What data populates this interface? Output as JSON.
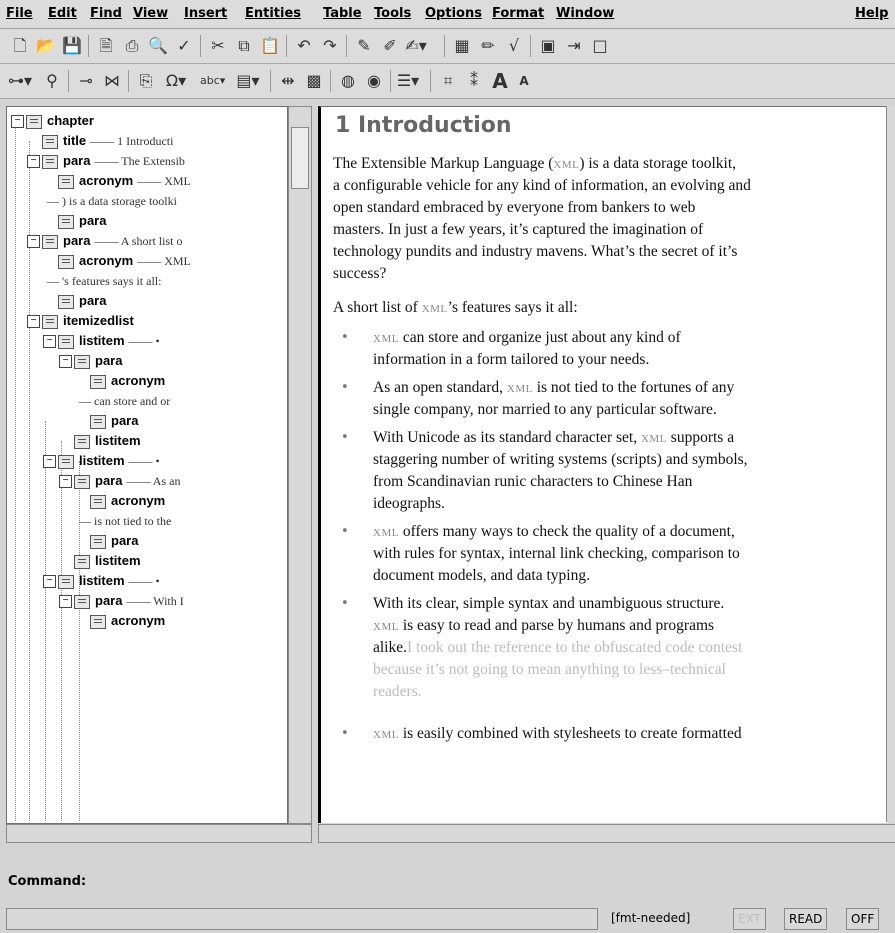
{
  "menubar": {
    "items": [
      "File",
      "Edit",
      "Find",
      "View",
      "Insert",
      "Entities",
      "Table",
      "Tools",
      "Options",
      "Format",
      "Window"
    ],
    "help": "Help"
  },
  "toolbar1": {
    "icons": [
      "new-document-icon",
      "open-folder-icon",
      "save-icon",
      "print-preview-icon",
      "print-icon",
      "find-icon",
      "spellcheck-icon",
      "cut-icon",
      "copy-icon",
      "paste-icon",
      "undo-icon",
      "redo-icon",
      "insert-element-icon",
      "split-element-icon",
      "change-element-icon",
      "table-icon",
      "edit-table-icon",
      "equation-icon",
      "image-icon",
      "export-icon",
      "layout-icon"
    ]
  },
  "toolbar2": {
    "icons": [
      "structure-icon",
      "zoom-icon",
      "link-icon",
      "markup-icon",
      "clipboard-icon",
      "special-char-icon",
      "text-style-icon",
      "entity-icon",
      "gutter-icon",
      "graphic-icon",
      "globe-icon",
      "web-icon",
      "list-icon",
      "tag-icon",
      "attributes-icon",
      "bigger-font-icon",
      "smaller-font-icon"
    ],
    "glyphs": {
      "omega": "Ω",
      "abc": "abc",
      "A_big": "A",
      "A_small": "A"
    }
  },
  "tree": {
    "nodes": [
      {
        "tag": "chapter",
        "preview": ""
      },
      {
        "tag": "title",
        "preview": "1 Introducti"
      },
      {
        "tag": "para",
        "preview": "The Extensib"
      },
      {
        "tag": "acronym",
        "preview": "XML"
      },
      {
        "tag": "",
        "preview": ") is a data storage toolki"
      },
      {
        "tag": "para",
        "preview": ""
      },
      {
        "tag": "para",
        "preview": "A short list o"
      },
      {
        "tag": "acronym",
        "preview": "XML"
      },
      {
        "tag": "",
        "preview": "'s features says it all:"
      },
      {
        "tag": "para",
        "preview": ""
      },
      {
        "tag": "itemizedlist",
        "preview": ""
      },
      {
        "tag": "listitem",
        "preview": "•"
      },
      {
        "tag": "para",
        "preview": ""
      },
      {
        "tag": "acronym",
        "preview": ""
      },
      {
        "tag": "",
        "preview": "can store and or"
      },
      {
        "tag": "para",
        "preview": ""
      },
      {
        "tag": "listitem",
        "preview": ""
      },
      {
        "tag": "listitem",
        "preview": "•"
      },
      {
        "tag": "para",
        "preview": "As an"
      },
      {
        "tag": "acronym",
        "preview": ""
      },
      {
        "tag": "",
        "preview": "is not tied to the"
      },
      {
        "tag": "para",
        "preview": ""
      },
      {
        "tag": "listitem",
        "preview": ""
      },
      {
        "tag": "listitem",
        "preview": "•"
      },
      {
        "tag": "para",
        "preview": "With I"
      },
      {
        "tag": "acronym",
        "preview": ""
      }
    ]
  },
  "doc": {
    "title": "1 Introduction",
    "para1": [
      "The Extensible Markup Language (",
      "XML",
      ") is a data storage toolkit,",
      "a configurable vehicle for any kind of information, an evolving and",
      "open standard embraced by everyone from bankers to web",
      "masters. In just a few years, it’s captured the imagination of",
      "technology pundits and industry mavens. What’s the secret of it’s",
      "success?"
    ],
    "para2": [
      "A short list of ",
      "XML",
      "’s features says it all:"
    ],
    "items": [
      [
        "XML",
        " can store and organize just about any kind of",
        "information in a form tailored to your needs."
      ],
      [
        "As an open standard, ",
        "XML",
        " is not tied to the fortunes of any",
        "single company, nor married to any particular software."
      ],
      [
        "With Unicode as its standard character set, ",
        "XML",
        " supports a",
        "staggering number of writing systems (scripts) and symbols,",
        "from Scandinavian runic characters to Chinese Han",
        "ideographs."
      ],
      [
        "XML",
        " offers many ways to check the quality of a document,",
        "with rules for syntax, internal link checking, comparison to",
        "document models, and data typing."
      ],
      [
        "With its clear, simple syntax and unambiguous structure.",
        "XML",
        " is easy to read and parse by humans and programs",
        "alike.",
        "I took out the reference to the obfuscated code contest",
        "because it’s not going to mean anything to less–technical",
        "readers."
      ],
      [
        "XML",
        " is easily combined with stylesheets to create formatted"
      ]
    ]
  },
  "command": {
    "label": "Command:"
  },
  "status": {
    "fmt": "[fmt-needed]",
    "ext": "EXT",
    "read": "READ",
    "off": "OFF"
  }
}
